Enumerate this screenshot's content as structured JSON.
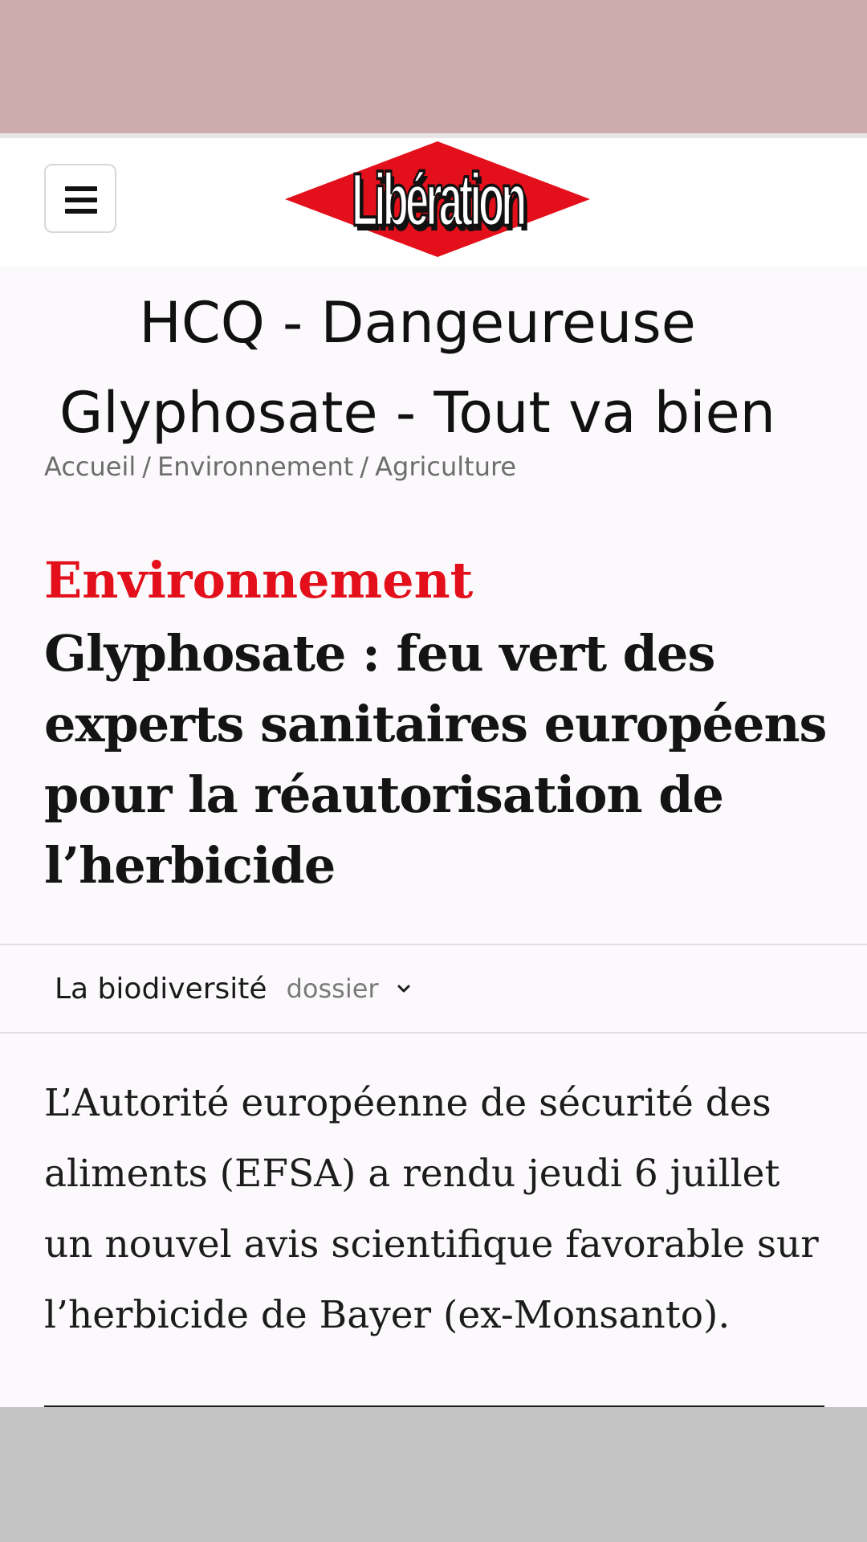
{
  "colors": {
    "top_band": "#cdacad",
    "bottom_band": "#c3c3c3",
    "kicker_red": "#e3101b",
    "logo_red": "#e3101b"
  },
  "header": {
    "menu_icon": "hamburger-icon",
    "logo_text": "Libération"
  },
  "overlay": {
    "title_line1": "HCQ - Dangeureuse",
    "title_line2": "Glyphosate - Tout va bien"
  },
  "breadcrumb": [
    "Accueil",
    "Environnement",
    "Agriculture"
  ],
  "article": {
    "kicker": "Environnement",
    "headline": "Glyphosate : feu vert des experts sanitaires européens pour la réautorisation de l’herbicide",
    "dossier": {
      "name": "La biodiversité",
      "tag": "dossier",
      "icon": "chevron-down-icon"
    },
    "lede": "L’Autorité européenne de sécurité des aliments (EFSA) a rendu jeudi 6 juillet un nouvel avis scientifique favorable sur l’herbicide de Bayer (ex-Monsanto)."
  }
}
